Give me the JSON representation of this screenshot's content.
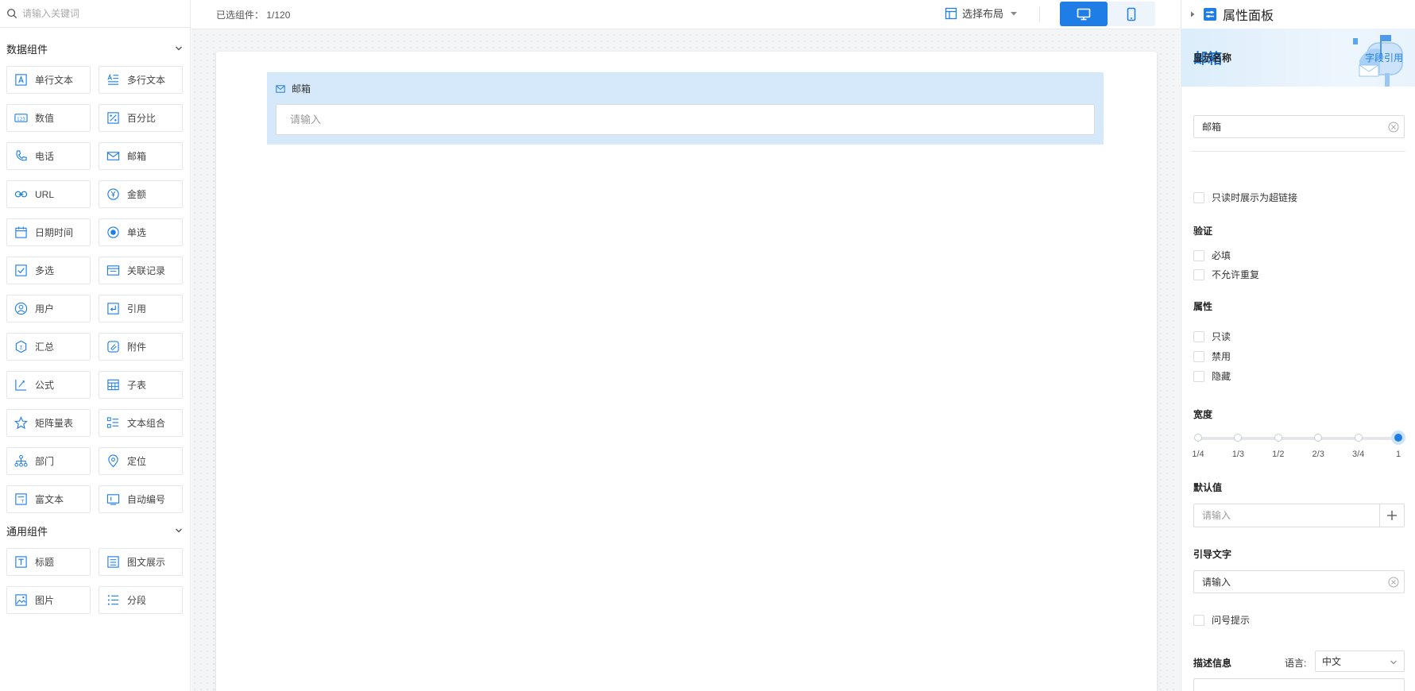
{
  "search": {
    "placeholder": "请输入关键词"
  },
  "groups": {
    "data": {
      "title": "数据组件"
    },
    "general": {
      "title": "通用组件"
    }
  },
  "data_components": [
    {
      "label": "单行文本",
      "icon": "text-box-icon"
    },
    {
      "label": "多行文本",
      "icon": "multiline-text-icon"
    },
    {
      "label": "数值",
      "icon": "number-icon"
    },
    {
      "label": "百分比",
      "icon": "percent-icon"
    },
    {
      "label": "电话",
      "icon": "phone-icon"
    },
    {
      "label": "邮箱",
      "icon": "mail-icon"
    },
    {
      "label": "URL",
      "icon": "link-icon"
    },
    {
      "label": "金额",
      "icon": "currency-yen-icon"
    },
    {
      "label": "日期时间",
      "icon": "calendar-icon"
    },
    {
      "label": "单选",
      "icon": "radio-icon"
    },
    {
      "label": "多选",
      "icon": "checkbox-icon"
    },
    {
      "label": "关联记录",
      "icon": "related-record-icon"
    },
    {
      "label": "用户",
      "icon": "user-icon"
    },
    {
      "label": "引用",
      "icon": "reference-icon"
    },
    {
      "label": "汇总",
      "icon": "summary-hexagon-icon"
    },
    {
      "label": "附件",
      "icon": "attachment-icon"
    },
    {
      "label": "公式",
      "icon": "formula-icon"
    },
    {
      "label": "子表",
      "icon": "subtable-icon"
    },
    {
      "label": "矩阵量表",
      "icon": "star-icon"
    },
    {
      "label": "文本组合",
      "icon": "text-combo-icon"
    },
    {
      "label": "部门",
      "icon": "org-chart-icon"
    },
    {
      "label": "定位",
      "icon": "location-pin-icon"
    },
    {
      "label": "富文本",
      "icon": "rich-text-icon"
    },
    {
      "label": "自动编号",
      "icon": "auto-number-icon"
    }
  ],
  "general_components": [
    {
      "label": "标题",
      "icon": "title-icon"
    },
    {
      "label": "图文展示",
      "icon": "image-text-icon"
    },
    {
      "label": "图片",
      "icon": "image-icon"
    },
    {
      "label": "分段",
      "icon": "segment-list-icon"
    }
  ],
  "topbar": {
    "selected_count": "已选组件：  1/120",
    "layout_label": "选择布局"
  },
  "canvas": {
    "field_label": "邮箱",
    "field_placeholder": "请输入"
  },
  "panel": {
    "header": "属性面板",
    "banner_title": "邮箱",
    "display_name_label": "显示名称",
    "field_ref_link": "字段引用",
    "display_name_value": "邮箱",
    "hyperlink_option": "只读时展示为超链接",
    "validation_label": "验证",
    "required": "必填",
    "no_duplicate": "不允许重复",
    "properties_label": "属性",
    "readonly": "只读",
    "disabled": "禁用",
    "hidden": "隐藏",
    "width_label": "宽度",
    "width_ticks": [
      "1/4",
      "1/3",
      "1/2",
      "2/3",
      "3/4",
      "1"
    ],
    "width_selected": "1",
    "default_value_label": "默认值",
    "default_value_placeholder": "请输入",
    "hint_text_label": "引导文字",
    "hint_text_value": "请输入",
    "question_tip": "问号提示",
    "description_label": "描述信息",
    "language_label": "语言:",
    "language_value": "中文"
  },
  "colors": {
    "accent": "#1f7ee6",
    "selected_field_bg": "#d6e9fb"
  }
}
